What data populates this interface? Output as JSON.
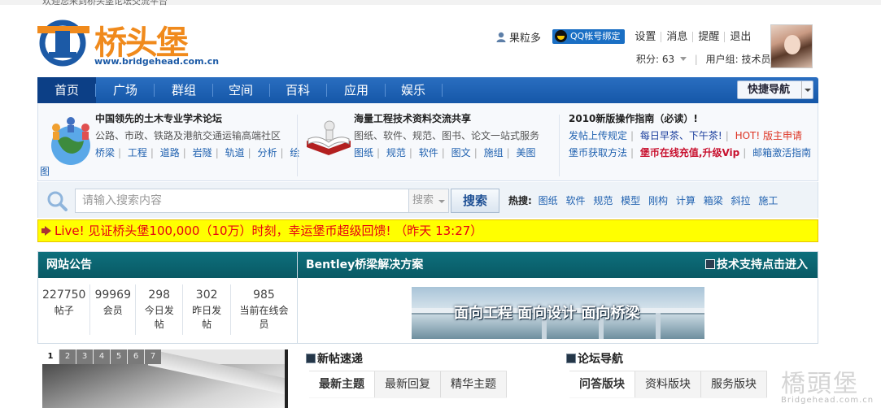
{
  "header": {
    "brand": "桥头堡",
    "url": "www.bridgehead.com.cn",
    "top_strip_text": "欢迎您来到桥头堡论坛交流平台"
  },
  "user": {
    "name": "果粒多",
    "qq_bind": "QQ帐号绑定",
    "links": [
      "设置",
      "消息",
      "提醒",
      "退出"
    ],
    "points_label": "积分: 63",
    "group_label": "用户组: 技术员"
  },
  "nav": {
    "items": [
      "首页",
      "广场",
      "群组",
      "空间",
      "百科",
      "应用",
      "娱乐"
    ],
    "quick": "快捷导航"
  },
  "info": {
    "col1": {
      "title": "中国领先的土木专业学术论坛",
      "sub": "公路、市政、铁路及港航交通运输高端社区",
      "tags": [
        "桥梁",
        "工程",
        "道路",
        "岩隧",
        "轨道",
        "分析",
        "绘"
      ],
      "tail": "图"
    },
    "col2": {
      "title": "海量工程技术资料交流共享",
      "sub": "图纸、软件、规范、图书、论文一站式服务",
      "tags": [
        "图纸",
        "规范",
        "软件",
        "图文",
        "施组",
        "美图"
      ]
    },
    "col3": {
      "title": "2010新版操作指南（必读）!",
      "row1": [
        "发帖上传规定",
        "每日早茶、下午茶!",
        "HOT! 版主申请"
      ],
      "row2": [
        "堡币获取方法",
        "堡币在线充值,升级Vip",
        "邮箱激活指南"
      ]
    }
  },
  "search": {
    "placeholder": "请输入搜索内容",
    "scope": "搜索",
    "button": "搜索",
    "hot_label": "热搜:",
    "hot": [
      "图纸",
      "软件",
      "规范",
      "模型",
      "刚构",
      "计算",
      "箱梁",
      "斜拉",
      "施工"
    ]
  },
  "announce": "Live! 见证桥头堡100,000（10万）时刻，幸运堡币超级回馈! （昨天 13:27）",
  "notice": {
    "title": "网站公告",
    "stats": [
      {
        "num": "227750",
        "label": "帖子"
      },
      {
        "num": "99969",
        "label": "会员"
      },
      {
        "num": "298",
        "label": "今日发帖"
      },
      {
        "num": "302",
        "label": "昨日发帖"
      },
      {
        "num": "985",
        "label": "当前在线会员"
      }
    ]
  },
  "bentley": {
    "title": "Bentley桥梁解决方案",
    "tech": "技术支持点击进入",
    "banner": "面向工程 面向设计 面向桥梁"
  },
  "slider": {
    "dots": [
      "1",
      "2",
      "3",
      "4",
      "5",
      "6",
      "7"
    ]
  },
  "latest": {
    "title": "新帖速递",
    "tabs": [
      "最新主题",
      "最新回复",
      "精华主题"
    ]
  },
  "forum_nav": {
    "title": "论坛导航",
    "tabs": [
      "问答版块",
      "资料版块",
      "服务版块"
    ]
  },
  "watermark": {
    "big": "橋頭堡",
    "small": "Bridgehead.com.cn"
  },
  "colors": {
    "nav_blue": "#1557a8",
    "teal": "#0d6f7c",
    "announce_bg": "#ffff00",
    "announce_text": "#e60012",
    "brand_orange": "#f08a1c"
  }
}
